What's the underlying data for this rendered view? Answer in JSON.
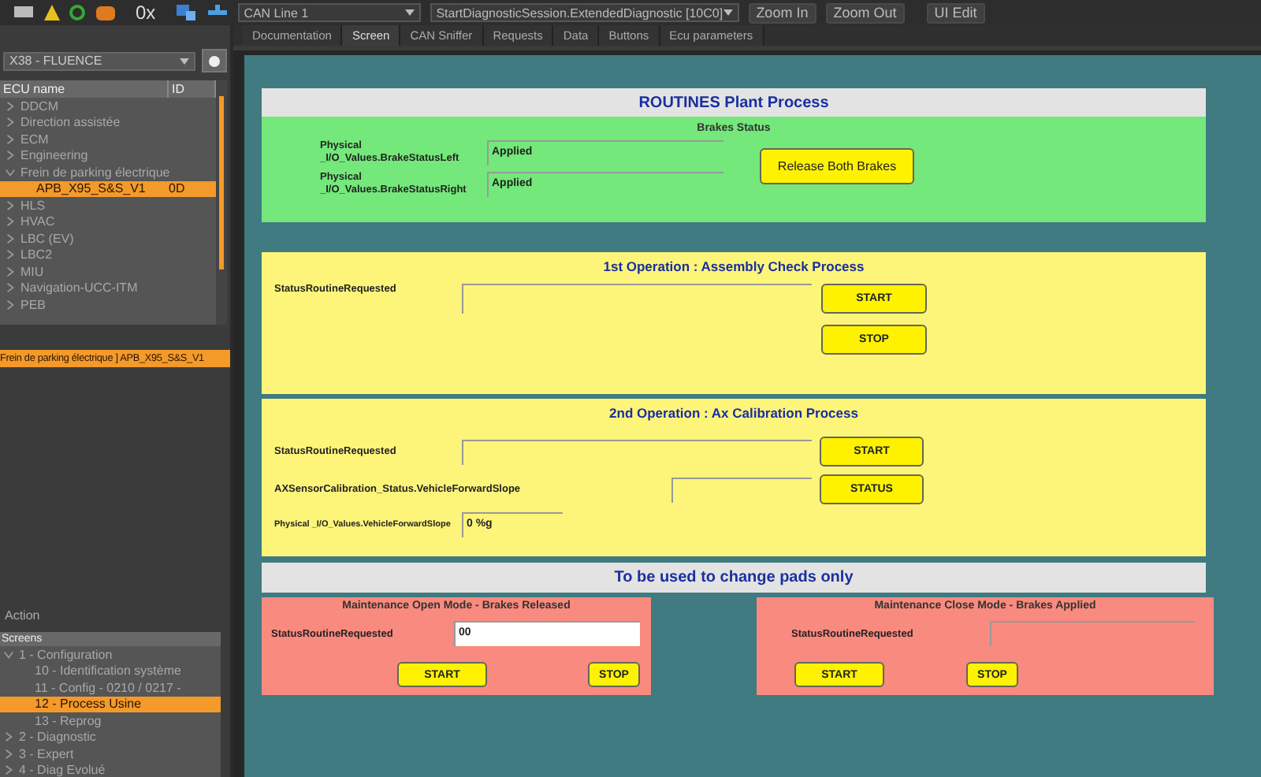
{
  "toolbar": {
    "counter": "0x",
    "can_line": "CAN Line 1",
    "session": "StartDiagnosticSession.ExtendedDiagnostic [10C0]",
    "buttons": [
      "Zoom In",
      "Zoom Out",
      "UI Edit"
    ]
  },
  "tabs": [
    {
      "label": "Documentation",
      "selected": false
    },
    {
      "label": "Screen",
      "selected": true
    },
    {
      "label": "CAN Sniffer",
      "selected": false
    },
    {
      "label": "Requests",
      "selected": false
    },
    {
      "label": "Data",
      "selected": false
    },
    {
      "label": "Buttons",
      "selected": false
    },
    {
      "label": "Ecu parameters",
      "selected": false
    }
  ],
  "vehicle": "X38 - FLUENCE",
  "ecu_tree": {
    "columns": [
      "ECU name",
      "ID"
    ],
    "items": [
      {
        "name": "DDCM",
        "expanded": false,
        "selected": false
      },
      {
        "name": "Direction assistée",
        "expanded": false,
        "selected": false
      },
      {
        "name": "ECM",
        "expanded": false,
        "selected": false
      },
      {
        "name": "Engineering",
        "expanded": false,
        "selected": false
      },
      {
        "name": "Frein de parking électrique",
        "expanded": true,
        "selected": false,
        "children": [
          {
            "name": "APB_X95_S&S_V1",
            "id": "0D",
            "selected": true
          }
        ]
      },
      {
        "name": "HLS",
        "expanded": false,
        "selected": false
      },
      {
        "name": "HVAC",
        "expanded": false,
        "selected": false
      },
      {
        "name": "LBC (EV)",
        "expanded": false,
        "selected": false
      },
      {
        "name": "LBC2",
        "expanded": false,
        "selected": false
      },
      {
        "name": "MIU",
        "expanded": false,
        "selected": false
      },
      {
        "name": "Navigation-UCC-ITM",
        "expanded": false,
        "selected": false
      },
      {
        "name": "PEB",
        "expanded": false,
        "selected": false
      }
    ]
  },
  "selected_ecu": "Frein de parking électrique ] APB_X95_S&S_V1",
  "action": {
    "title": "Action",
    "header": "Screens",
    "items": [
      {
        "name": "1 - Configuration",
        "expanded": true,
        "selected": false,
        "children": [
          {
            "name": "10 - Identification système",
            "selected": false
          },
          {
            "name": "11 - Config - 0210 / 0217 -",
            "selected": false
          },
          {
            "name": "12 - Process Usine",
            "selected": true
          },
          {
            "name": "13 - Reprog",
            "selected": false
          }
        ]
      },
      {
        "name": "2 - Diagnostic",
        "expanded": false,
        "selected": false
      },
      {
        "name": "3 - Expert",
        "expanded": false,
        "selected": false
      },
      {
        "name": "4 - Diag Evolué",
        "expanded": false,
        "selected": false
      }
    ]
  },
  "screen": {
    "title": "ROUTINES Plant Process",
    "brakes": {
      "title": "Brakes Status",
      "rows": [
        {
          "label": "Physical _I/O_Values.BrakeStatusLeft",
          "value": "Applied"
        },
        {
          "label": "Physical _I/O_Values.BrakeStatusRight",
          "value": "Applied"
        }
      ],
      "button": "Release Both Brakes"
    },
    "op1": {
      "title": "1st Operation : Assembly Check Process",
      "label": "StatusRoutineRequested",
      "buttons": [
        "START",
        "STOP"
      ]
    },
    "op2": {
      "title": "2nd Operation : Ax Calibration Process",
      "rows": [
        {
          "label": "StatusRoutineRequested",
          "button": "START"
        },
        {
          "label": "AXSensorCalibration_Status.VehicleForwardSlope",
          "button": "STATUS"
        },
        {
          "label": "Physical _I/O_Values.VehicleForwardSlope",
          "value": "0 %g"
        }
      ]
    },
    "pads_title": "To be used to change pads only",
    "maintenance": [
      {
        "title": "Maintenance Open Mode - Brakes Released",
        "label": "StatusRoutineRequested",
        "value": "00",
        "buttons": [
          "START",
          "STOP"
        ]
      },
      {
        "title": "Maintenance Close Mode - Brakes Applied",
        "label": "StatusRoutineRequested",
        "buttons": [
          "START",
          "STOP"
        ]
      }
    ]
  }
}
